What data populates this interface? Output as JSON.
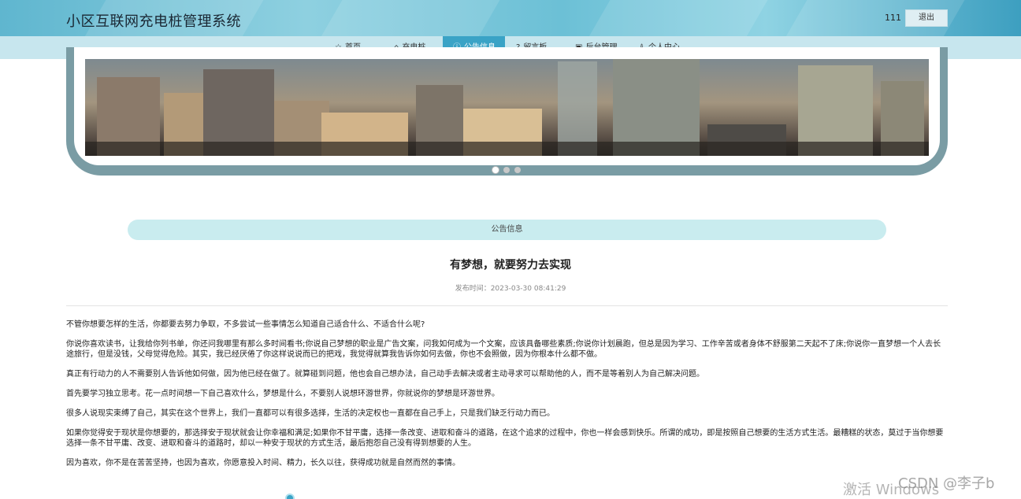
{
  "header": {
    "site_title": "小区互联网充电桩管理系统",
    "user_name": "111",
    "logout_label": "退出"
  },
  "nav": {
    "items": [
      {
        "label": "首页",
        "icon": "star-icon",
        "glyph": "☆"
      },
      {
        "label": "充电桩",
        "icon": "lock-icon",
        "glyph": "⌂"
      },
      {
        "label": "公告信息",
        "icon": "info-icon",
        "glyph": "ⓘ"
      },
      {
        "label": "留言板",
        "icon": "question-icon",
        "glyph": "?"
      },
      {
        "label": "后台管理",
        "icon": "briefcase-icon",
        "glyph": "▣"
      },
      {
        "label": "个人中心",
        "icon": "user-icon",
        "glyph": "♙"
      }
    ],
    "active_index": 2
  },
  "carousel": {
    "slide_count": 3,
    "active_slide": 1
  },
  "section": {
    "title": "公告信息"
  },
  "article": {
    "title": "有梦想，就要努力去实现",
    "meta_label": "发布时间：",
    "publish_time": "2023-03-30 08:41:29",
    "paragraphs": [
      "不管你想要怎样的生活，你都要去努力争取，不多尝试一些事情怎么知道自己适合什么、不适合什么呢?",
      "你说你喜欢读书，让我给你列书单，你还问我哪里有那么多时间看书;你说自己梦想的职业是广告文案，问我如何成为一个文案，应该具备哪些素质;你说你计划晨跑，但总是因为学习、工作辛苦或者身体不舒服第二天起不了床;你说你一直梦想一个人去长途旅行，但是没钱，父母觉得危险。其实，我已经厌倦了你这样说说而已的把戏，我觉得就算我告诉你如何去做，你也不会照做，因为你根本什么都不做。",
      "真正有行动力的人不需要别人告诉他如何做，因为他已经在做了。就算碰到问题，他也会自己想办法，自己动手去解决或者主动寻求可以帮助他的人，而不是等着别人为自己解决问题。",
      "首先要学习独立思考。花一点时间想一下自己喜欢什么，梦想是什么，不要别人说想环游世界，你就说你的梦想是环游世界。",
      "很多人说现实束缚了自己，其实在这个世界上，我们一直都可以有很多选择，生活的决定权也一直都在自己手上，只是我们缺乏行动力而已。",
      "如果你觉得安于现状是你想要的，那选择安于现状就会让你幸福和满足;如果你不甘平庸，选择一条改变、进取和奋斗的道路，在这个追求的过程中，你也一样会感到快乐。所谓的成功，即是按照自己想要的生活方式生活。最糟糕的状态，莫过于当你想要选择一条不甘平庸、改变、进取和奋斗的道路时，却以一种安于现状的方式生活，最后抱怨自己没有得到想要的人生。",
      "因为喜欢，你不是在苦苦坚持，也因为喜欢，你愿意投入时间、精力，长久以往，获得成功就是自然而然的事情。"
    ]
  },
  "watermarks": {
    "windows": "激活 Windows",
    "csdn": "CSDN @李子b"
  }
}
